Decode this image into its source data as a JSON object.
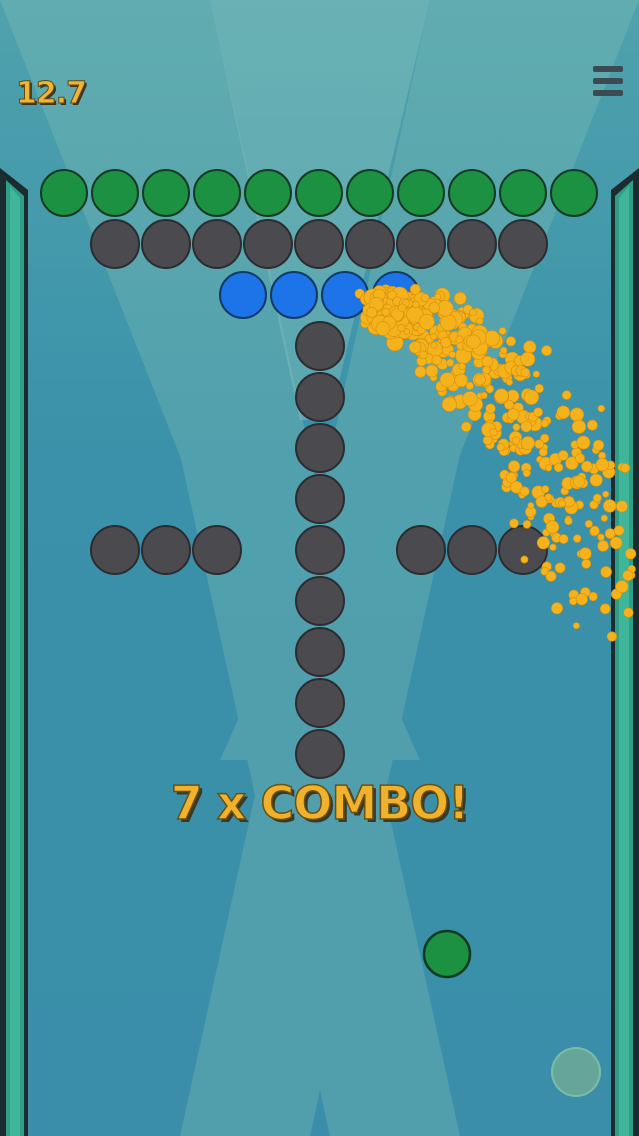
{
  "hud": {
    "timer": "12.7",
    "menu_icon": "hamburger-menu-icon"
  },
  "combo": {
    "text": "7 x COMBO!"
  },
  "colors": {
    "green_ball": "#1c9141",
    "gray_ball": "#4b4b4f",
    "blue_ball": "#1d74e8",
    "particle": "#f4b21c",
    "wall": "#2e9e87",
    "wall_edge": "#1a2c30",
    "text": "#f0b22c"
  },
  "board": {
    "rows": [
      {
        "color": "green",
        "count": 11
      },
      {
        "color": "gray",
        "count": 9
      },
      {
        "color": "blue",
        "count": 4
      }
    ],
    "column": {
      "color": "gray",
      "count": 9
    },
    "side_arms": {
      "color": "gray",
      "left_count": 3,
      "right_count": 3
    }
  },
  "shooter": {
    "ball_color": "green"
  },
  "action_button": {
    "icon": "fire-button-icon"
  }
}
